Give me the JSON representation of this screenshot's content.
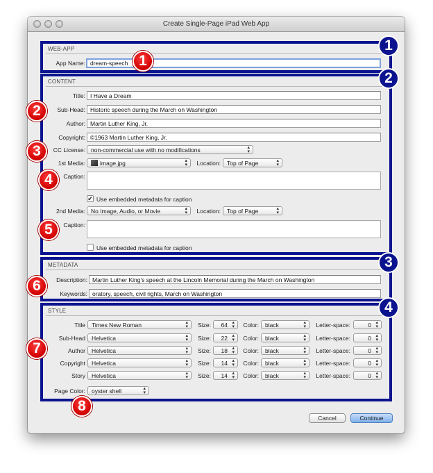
{
  "window": {
    "title": "Create Single-Page iPad Web App"
  },
  "webapp": {
    "section": "WEB-APP",
    "app_name_label": "App Name:",
    "app_name_value": "dream-speech"
  },
  "content": {
    "section": "CONTENT",
    "title_label": "Title:",
    "title_value": "I Have a Dream",
    "subhead_label": "Sub-Head:",
    "subhead_value": "Historic speech during the March on Washington",
    "author_label": "Author:",
    "author_value": "Martin Luther King, Jr.",
    "copyright_label": "Copyright:",
    "copyright_value": "©1963 Martin Luther King, Jr.",
    "cc_label": "CC License:",
    "cc_value": "non-commercial use with no modifications",
    "media1_label": "1st Media:",
    "media1_value": "image.jpg",
    "location_label": "Location:",
    "location1_value": "Top of Page",
    "caption_label": "Caption:",
    "embedded_label": "Use embedded metadata for caption",
    "embedded1_checked": "✔",
    "media2_label": "2nd Media:",
    "media2_value": "No Image, Audio, or Movie",
    "location2_value": "Top of Page"
  },
  "metadata": {
    "section": "METADATA",
    "description_label": "Description:",
    "description_value": "Martin Luther King's speech at the Lincoln Memorial during the March on Washington",
    "keywords_label": "Keywords:",
    "keywords_value": "oratory, speech, civil rights, March on Washington"
  },
  "style": {
    "section": "STYLE",
    "size_label": "Size:",
    "color_label": "Color:",
    "letterspace_label": "Letter-space:",
    "rows": [
      {
        "label": "Title",
        "font": "Times New Roman",
        "size": "64",
        "color": "black",
        "letterspace": "0"
      },
      {
        "label": "Sub-Head",
        "font": "Helvetica",
        "size": "22",
        "color": "black",
        "letterspace": "0"
      },
      {
        "label": "Author",
        "font": "Helvetica",
        "size": "18",
        "color": "black",
        "letterspace": "0"
      },
      {
        "label": "Copyright",
        "font": "Helvetica",
        "size": "14",
        "color": "black",
        "letterspace": "0"
      },
      {
        "label": "Story",
        "font": "Helvetica",
        "size": "14",
        "color": "black",
        "letterspace": "0"
      }
    ],
    "page_color_label": "Page Color:",
    "page_color_value": "oyster shell"
  },
  "buttons": {
    "cancel": "Cancel",
    "continue": "Continue"
  },
  "annotations": {
    "red": [
      "1",
      "2",
      "3",
      "4",
      "5",
      "6",
      "7",
      "8"
    ],
    "blue": [
      "1",
      "2",
      "3",
      "4"
    ]
  },
  "colors": {
    "highlight_border": "#0b138f",
    "badge_red": "#d00000"
  }
}
